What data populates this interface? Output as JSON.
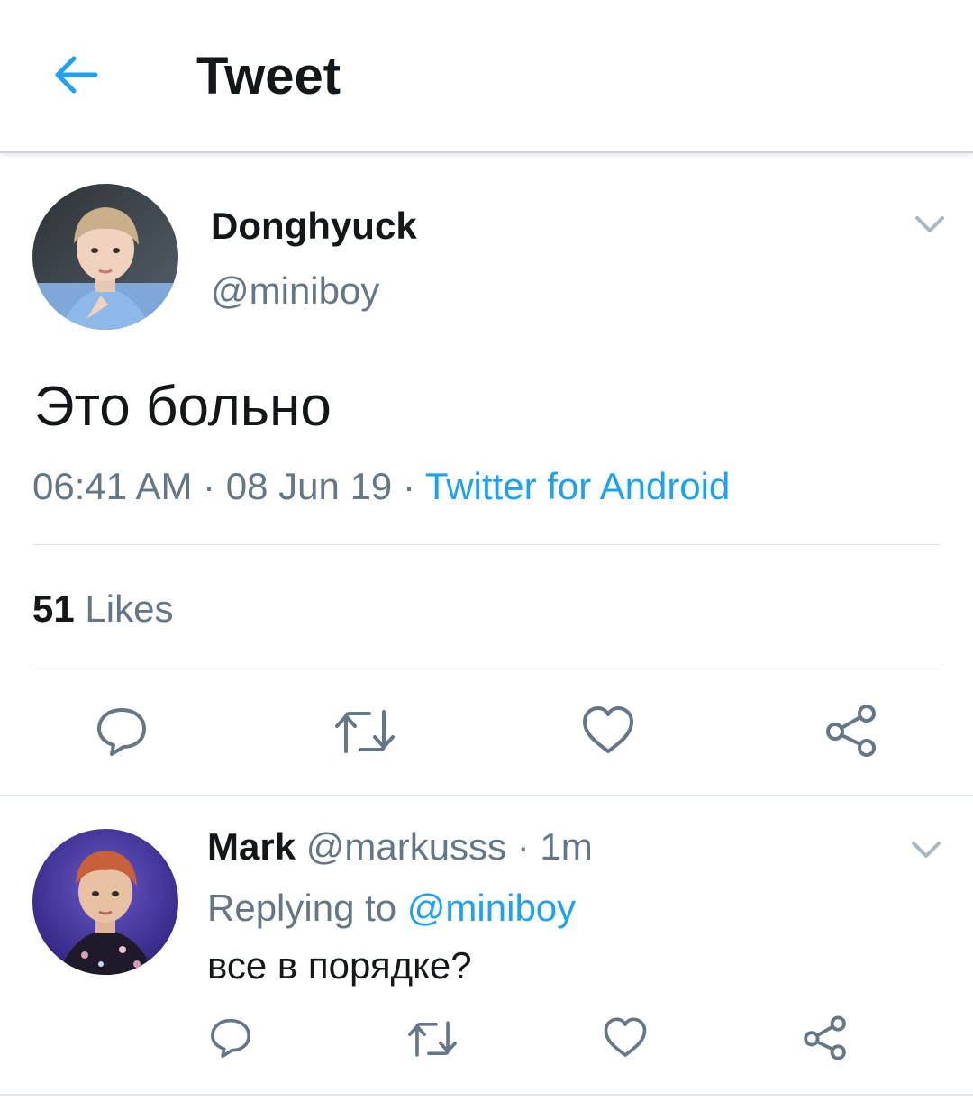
{
  "header": {
    "title": "Tweet",
    "back_icon": "arrow-left-icon"
  },
  "colors": {
    "accent": "#1da1f2",
    "secondary_text": "#657786",
    "primary_text": "#14171a"
  },
  "tweet": {
    "name": "Donghyuck",
    "handle": "@miniboy",
    "text": "Это больно",
    "time": "06:41 AM",
    "date": "08 Jun 19",
    "separator": " · ",
    "source": "Twitter for Android",
    "likes_count": "51",
    "likes_label": "Likes",
    "actions": [
      "reply-icon",
      "retweet-icon",
      "like-icon",
      "share-icon"
    ]
  },
  "reply": {
    "name": "Mark",
    "handle": "@markusss",
    "separator": " · ",
    "time": "1m",
    "replying_label": "Replying to",
    "replying_to": "@miniboy",
    "text": "все в порядке?",
    "actions": [
      "reply-icon",
      "retweet-icon",
      "like-icon",
      "share-icon"
    ]
  }
}
